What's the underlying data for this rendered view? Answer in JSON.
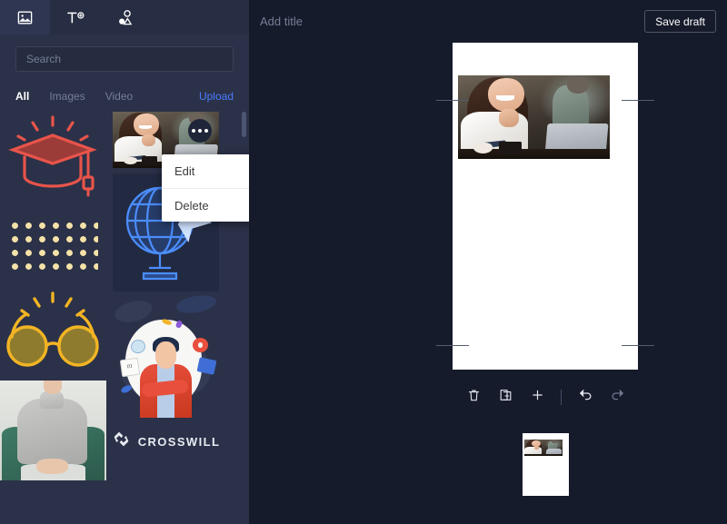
{
  "sidebar": {
    "tabs": [
      {
        "icon": "image-icon",
        "name": "media",
        "active": true
      },
      {
        "icon": "text-add-icon",
        "name": "text",
        "active": false
      },
      {
        "icon": "shapes-icon",
        "name": "elements",
        "active": false
      }
    ],
    "search": {
      "value": "",
      "placeholder": "Search"
    },
    "filters": [
      {
        "label": "All",
        "active": true
      },
      {
        "label": "Images",
        "active": false
      },
      {
        "label": "Video",
        "active": false
      }
    ],
    "upload_label": "Upload",
    "media_items": [
      {
        "name": "graduation-cap-illustration",
        "kind": "cap"
      },
      {
        "name": "woman-laptop-photo",
        "kind": "photo-cafe"
      },
      {
        "name": "dot-pattern-illustration",
        "kind": "dots"
      },
      {
        "name": "globe-paperplane-illustration",
        "kind": "globe"
      },
      {
        "name": "glasses-illustration",
        "kind": "glasses"
      },
      {
        "name": "man-thinking-illustration",
        "kind": "thinker"
      },
      {
        "name": "woman-sweater-photo",
        "kind": "photo-sweater"
      },
      {
        "name": "crosswill-logo",
        "kind": "logo",
        "text": "CROSSWILL"
      }
    ]
  },
  "context_menu": {
    "visible": true,
    "items": [
      {
        "label": "Edit",
        "name": "edit"
      },
      {
        "label": "Delete",
        "name": "delete"
      }
    ]
  },
  "topbar": {
    "title": {
      "value": "",
      "placeholder": "Add title"
    },
    "save_draft_label": "Save draft"
  },
  "canvas": {
    "page_number": 1,
    "guides_visible": true,
    "selected_element": "woman-laptop-photo",
    "toolbar": [
      {
        "name": "delete-page-button",
        "icon": "trash-icon",
        "enabled": true
      },
      {
        "name": "duplicate-page-button",
        "icon": "duplicate-icon",
        "enabled": true
      },
      {
        "name": "add-page-button",
        "icon": "plus-icon",
        "enabled": true
      },
      {
        "name": "undo-button",
        "icon": "undo-icon",
        "enabled": true
      },
      {
        "name": "redo-button",
        "icon": "redo-icon",
        "enabled": false
      }
    ]
  },
  "colors": {
    "app_background": "#161b2b",
    "sidebar_background": "#2b3148",
    "tabbar_background": "#272d42",
    "accent_blue": "#4a7dff",
    "text_primary": "#ffffff",
    "text_muted": "#767e97",
    "menu_background": "#ffffff",
    "canvas_white": "#ffffff"
  }
}
